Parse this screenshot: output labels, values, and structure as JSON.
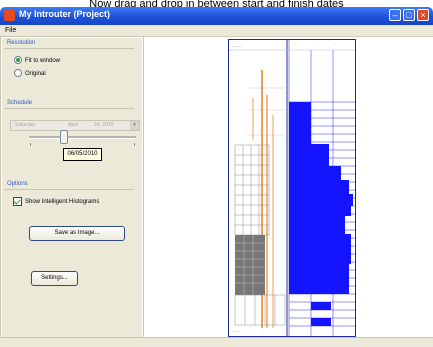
{
  "caption": "Now drag and drop in between start and finish dates",
  "window": {
    "title": "My Introuter (Project)"
  },
  "menu": {
    "file_label": "File"
  },
  "resolution": {
    "group_title": "Resolution",
    "options": [
      {
        "label": "Fit to window",
        "selected": true
      },
      {
        "label": "Original",
        "selected": false
      }
    ]
  },
  "schedule": {
    "group_title": "Schedule",
    "date_field": {
      "day": "Saturday",
      "month": "April",
      "date": "24, 2010"
    },
    "slider_tooltip": "06/05/2010"
  },
  "options": {
    "group_title": "Options",
    "histogram_label": "Show Intelligent Histograms",
    "histogram_checked": true,
    "save_image_label": "Save as Image...",
    "settings_label": "Settings..."
  },
  "colors": {
    "titlebar": "#1f52d8",
    "histogram_bar": "#1414ff",
    "schedule_bar": "#f0a050",
    "panel": "#ece9d8"
  }
}
